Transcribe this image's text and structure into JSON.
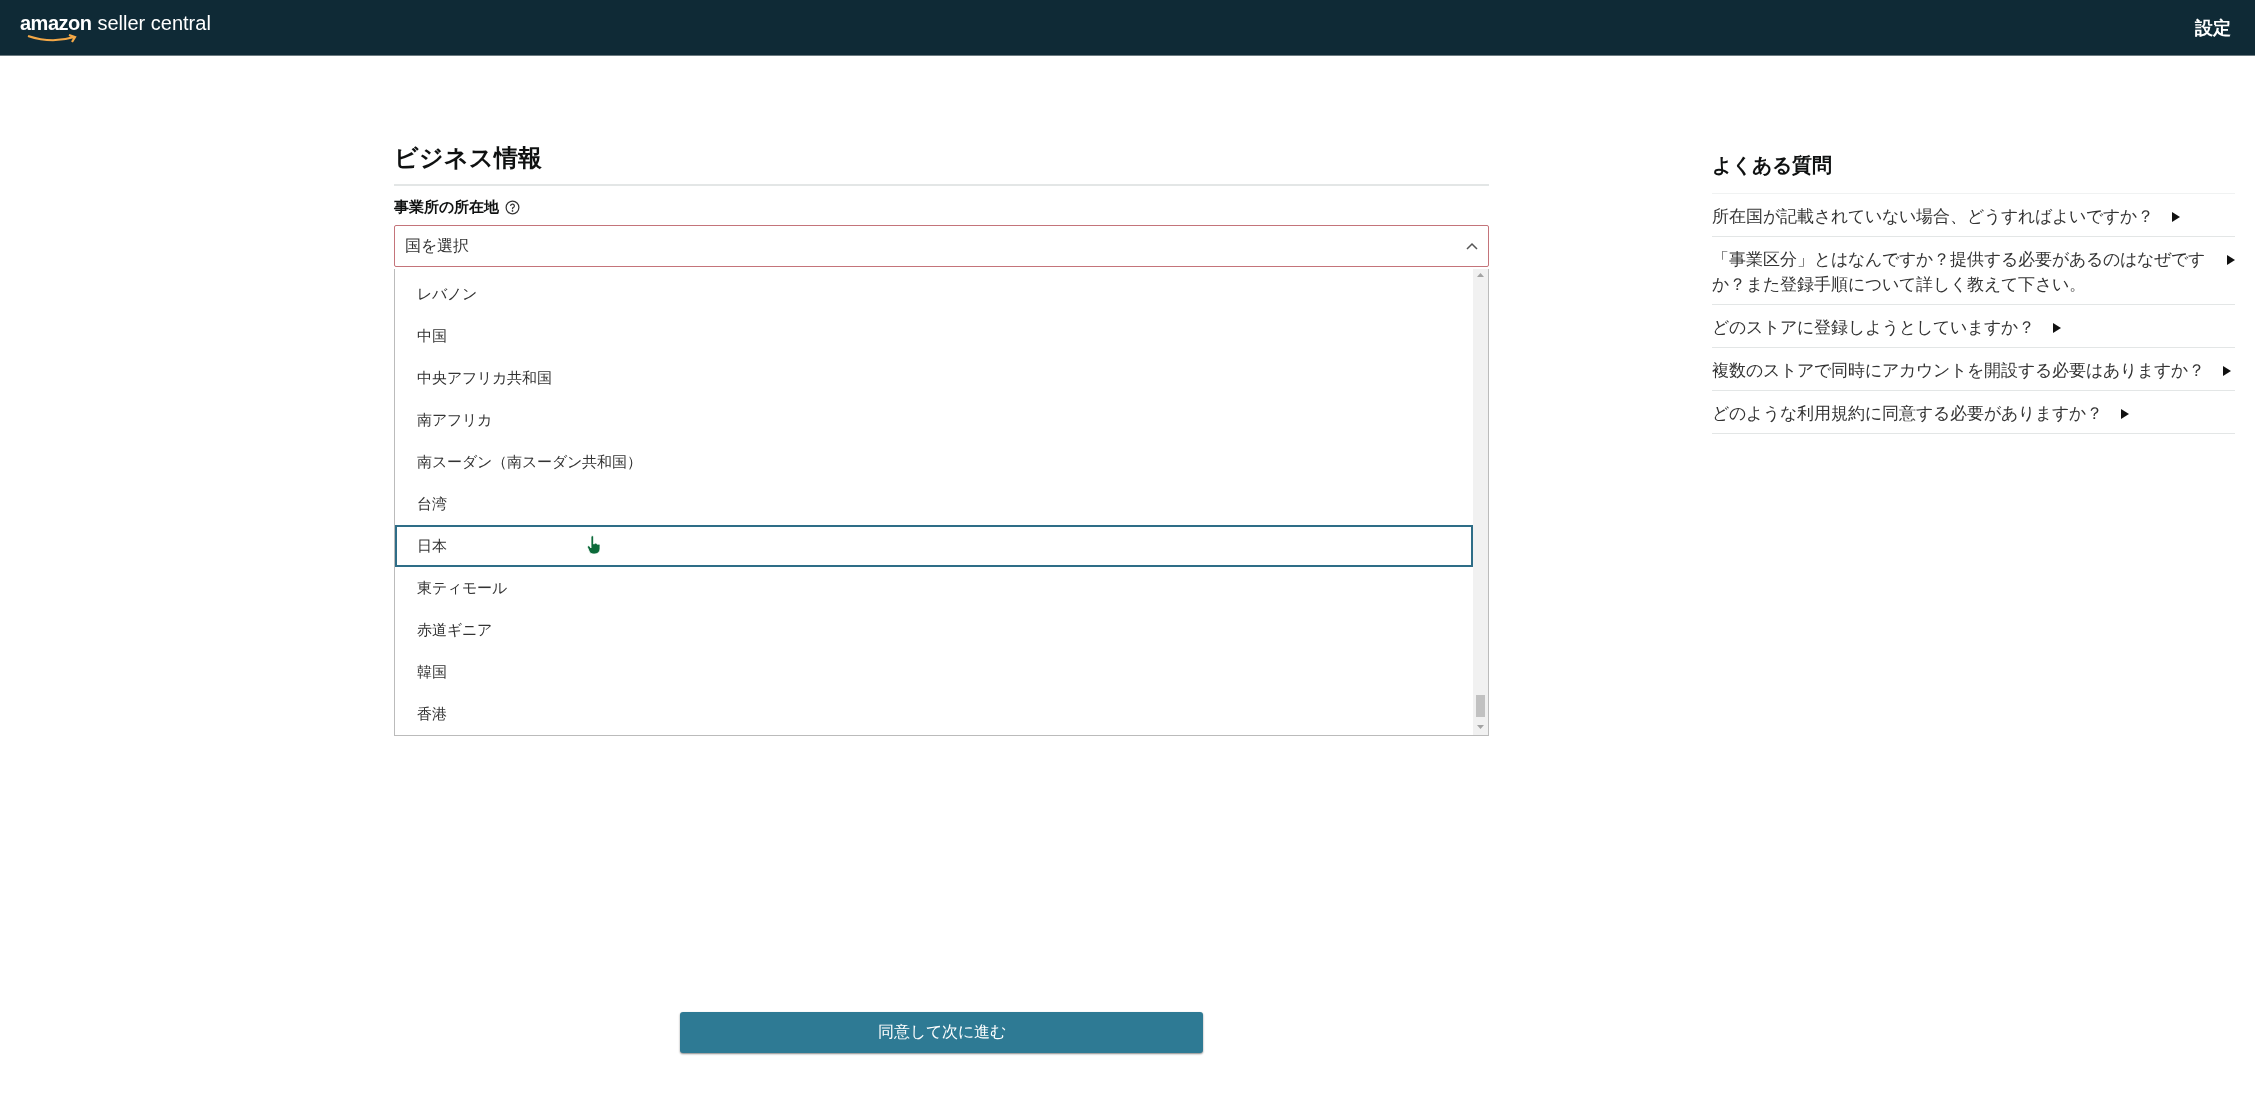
{
  "header": {
    "logo": {
      "brand": "amazon",
      "product": "seller central"
    },
    "settings": "設定"
  },
  "form": {
    "title": "ビジネス情報",
    "field_label": "事業所の所在地",
    "select": {
      "placeholder": "国を選択",
      "expanded": true
    },
    "options": [
      {
        "label": "レバノン",
        "selected": false
      },
      {
        "label": "中国",
        "selected": false
      },
      {
        "label": "中央アフリカ共和国",
        "selected": false
      },
      {
        "label": "南アフリカ",
        "selected": false
      },
      {
        "label": "南スーダン（南スーダン共和国）",
        "selected": false
      },
      {
        "label": "台湾",
        "selected": false
      },
      {
        "label": "日本",
        "selected": true
      },
      {
        "label": "東ティモール",
        "selected": false
      },
      {
        "label": "赤道ギニア",
        "selected": false
      },
      {
        "label": "韓国",
        "selected": false
      },
      {
        "label": "香港",
        "selected": false
      }
    ],
    "submit": "同意して次に進む"
  },
  "faq": {
    "title": "よくある質問",
    "items": [
      "所在国が記載されていない場合、どうすればよいですか？",
      "「事業区分」とはなんですか？提供する必要があるのはなぜですか？また登録手順について詳しく教えて下さい。",
      "どのストアに登録しようとしていますか？",
      "複数のストアで同時にアカウントを開設する必要はありますか？",
      "どのような利用規約に同意する必要がありますか？"
    ]
  }
}
